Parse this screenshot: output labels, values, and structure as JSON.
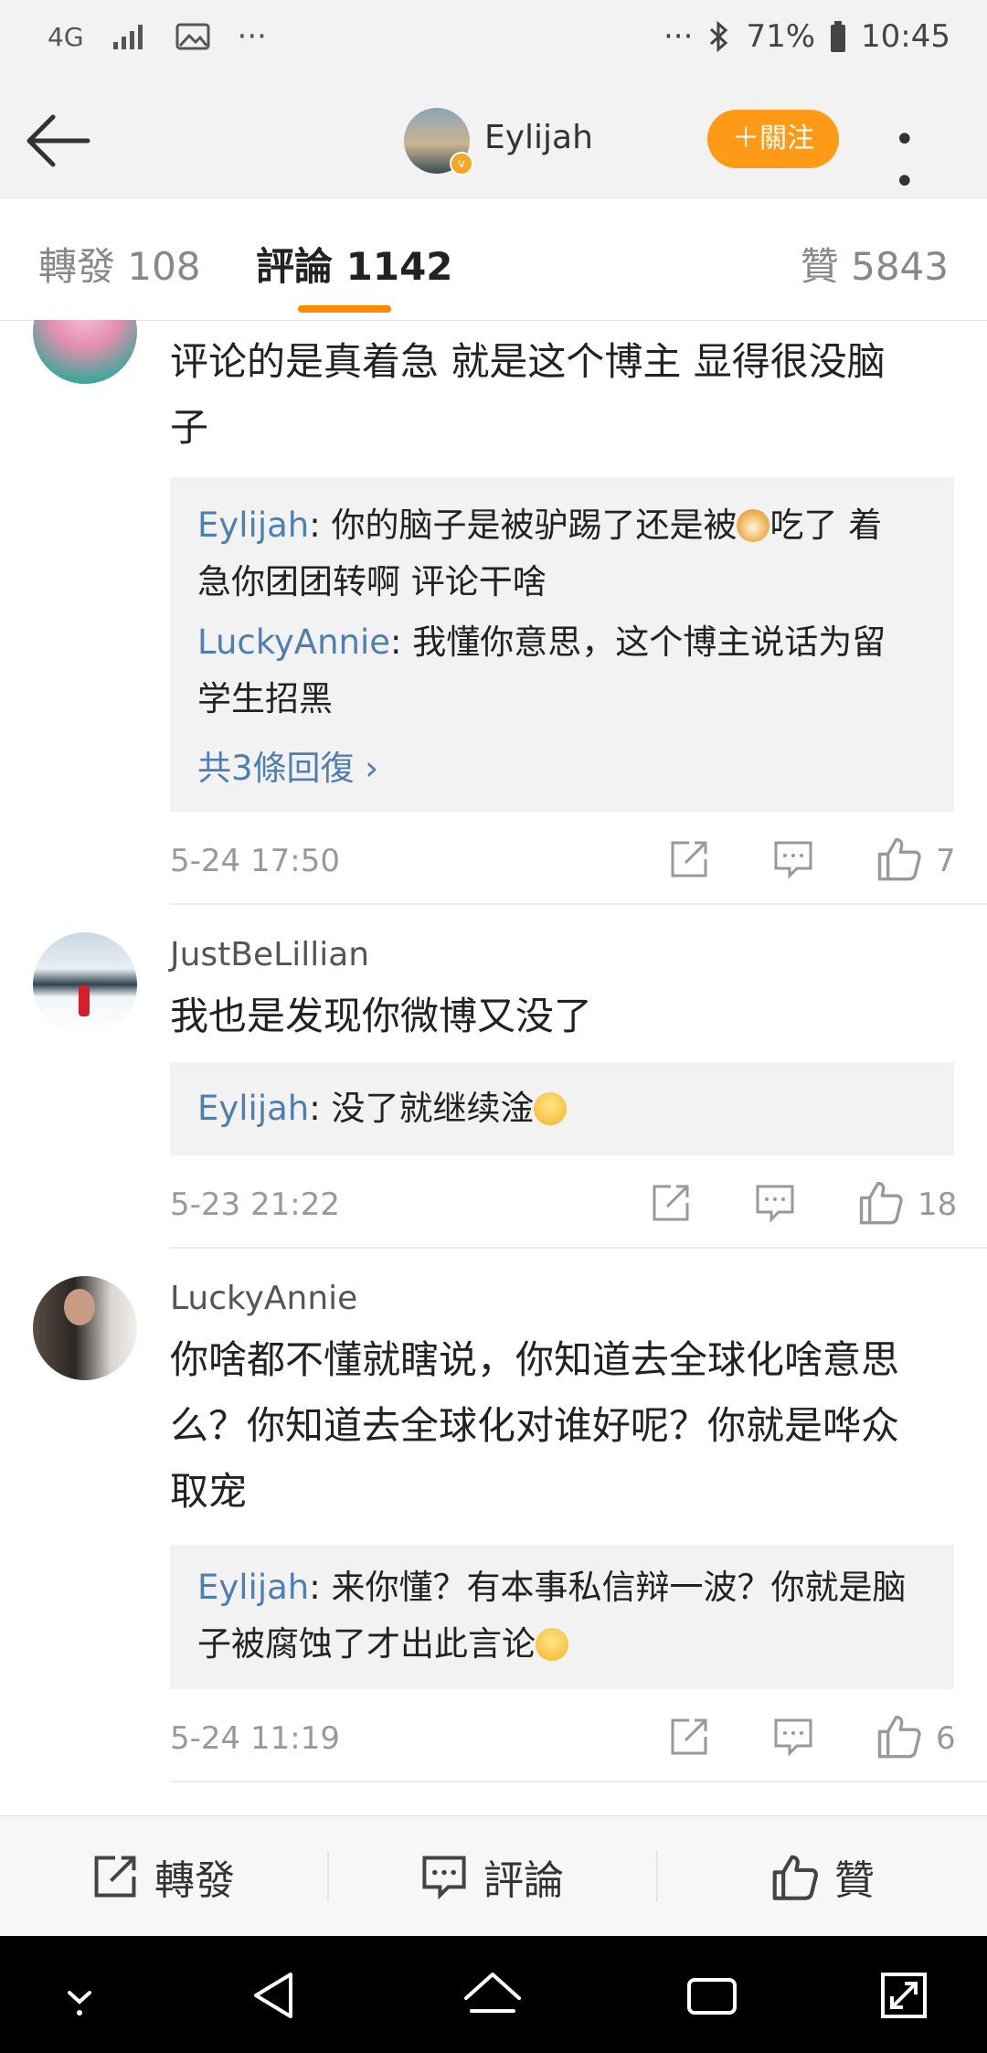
{
  "status_bar": {
    "network": "4G",
    "dots_left": "···",
    "dots_right": "···",
    "battery": "71%",
    "time": "10:45"
  },
  "nav": {
    "username": "Eylijah",
    "follow_label": "＋關注",
    "more_label": "• • •"
  },
  "tabs": [
    {
      "label": "轉發 108"
    },
    {
      "label": "評論 1142"
    },
    {
      "label": "贊 5843"
    }
  ],
  "comments": [
    {
      "text_line1": "评论的是真着急 就是这个博主 显得很没脑",
      "text_line2": "子",
      "replies": [
        {
          "author": "Eylijah",
          "text_a": ": 你的脑子是被驴踢了还是被",
          "text_b": "吃了 着",
          "text_c": "急你团团转啊 评论干啥"
        },
        {
          "author": "LuckyAnnie",
          "text_a": ": 我懂你意思，这个博主说话为留",
          "text_c": "学生招黑"
        }
      ],
      "more_replies": "共3條回復 ›",
      "time": "5-24 17:50",
      "likes": "7"
    },
    {
      "name": "JustBeLillian",
      "text_line1": "我也是发现你微博又没了",
      "replies": [
        {
          "author": "Eylijah",
          "text_a": ": 没了就继续淦"
        }
      ],
      "time": "5-23 21:22",
      "likes": "18"
    },
    {
      "name": "LuckyAnnie",
      "text_line1": "你啥都不懂就瞎说，你知道去全球化啥意思",
      "text_line2": "么？你知道去全球化对谁好呢？你就是哗众",
      "text_line3": "取宠",
      "replies": [
        {
          "author": "Eylijah",
          "text_a": ": 来你懂？有本事私信辩一波？你就是脑",
          "text_c": "子被腐蚀了才出此言论"
        }
      ],
      "time": "5-24 11:19",
      "likes": "6"
    }
  ],
  "bottom_bar": {
    "repost_label": "轉發",
    "comment_label": "評論",
    "like_label": "贊"
  },
  "colors": {
    "accent": "#ff9a17",
    "link": "#4e7fb0",
    "tab_indicator": "#ff8a00"
  }
}
